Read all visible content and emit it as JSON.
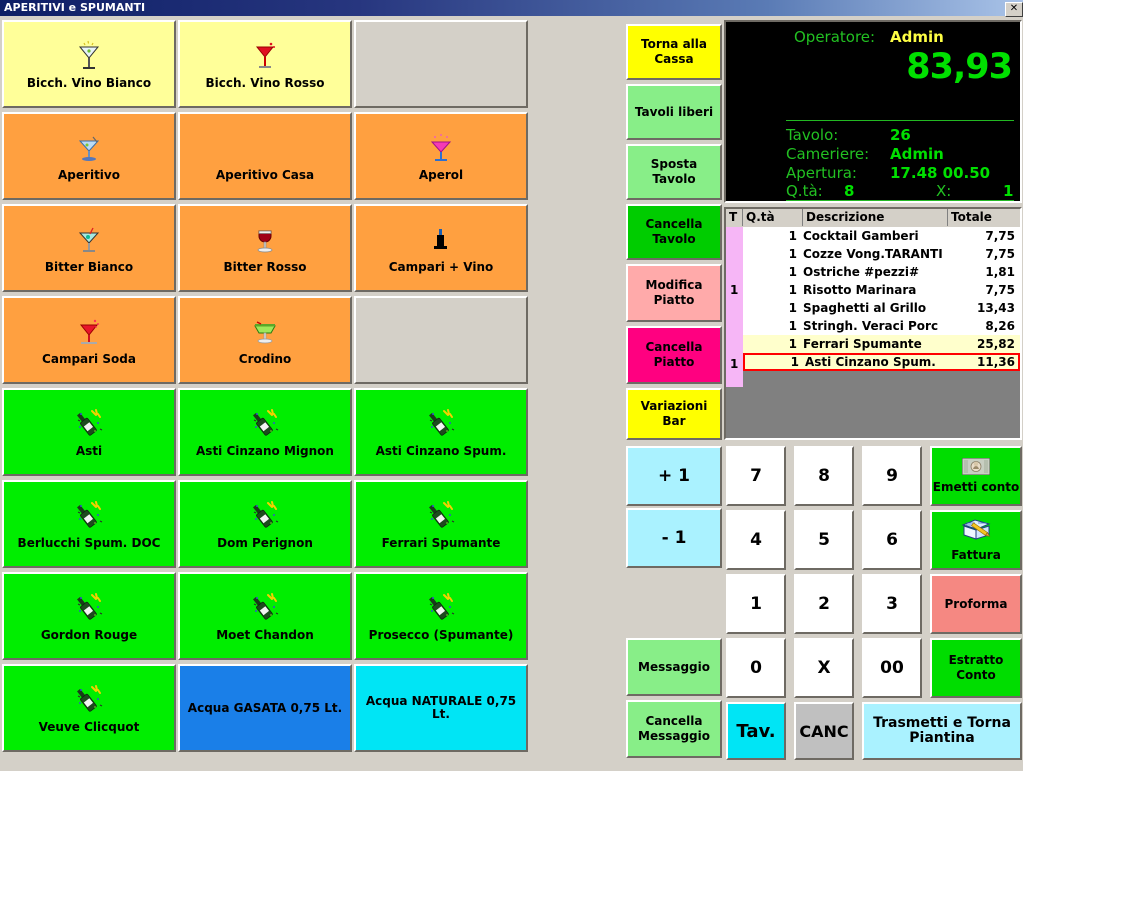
{
  "window": {
    "title": "APERITIVI e SPUMANTI",
    "close_label": "✕"
  },
  "products": [
    {
      "label": "Bicch. Vino Bianco",
      "color": "#ffff99",
      "icon": "cocktail-white-icon"
    },
    {
      "label": "Bicch. Vino Rosso",
      "color": "#ffff99",
      "icon": "cocktail-red-icon"
    },
    {
      "label": "",
      "color": "#d4d0c8",
      "icon": ""
    },
    {
      "label": "Aperitivo",
      "color": "#ffa040",
      "icon": "cocktail-blue-icon"
    },
    {
      "label": "Aperitivo Casa",
      "color": "#ffa040",
      "icon": "jester-icon"
    },
    {
      "label": "Aperol",
      "color": "#ffa040",
      "icon": "cocktail-pink-icon"
    },
    {
      "label": "Bitter Bianco",
      "color": "#ffa040",
      "icon": "cocktail-teal-icon"
    },
    {
      "label": "Bitter Rosso",
      "color": "#ffa040",
      "icon": "wineglass-red-icon"
    },
    {
      "label": "Campari + Vino",
      "color": "#ffa040",
      "icon": "bottle-small-icon"
    },
    {
      "label": "Campari Soda",
      "color": "#ffa040",
      "icon": "cocktail-red-splash-icon"
    },
    {
      "label": "Crodino",
      "color": "#ffa040",
      "icon": "margarita-green-icon"
    },
    {
      "label": "",
      "color": "#d4d0c8",
      "icon": ""
    },
    {
      "label": "Asti",
      "color": "#00ee00",
      "icon": "champagne-bottle-icon"
    },
    {
      "label": "Asti Cinzano Mignon",
      "color": "#00ee00",
      "icon": "champagne-bottle-icon"
    },
    {
      "label": "Asti Cinzano Spum.",
      "color": "#00ee00",
      "icon": "champagne-bottle-icon"
    },
    {
      "label": "Berlucchi Spum. DOC",
      "color": "#00ee00",
      "icon": "champagne-bottle-icon"
    },
    {
      "label": "Dom Perignon",
      "color": "#00ee00",
      "icon": "champagne-bottle-icon"
    },
    {
      "label": "Ferrari Spumante",
      "color": "#00ee00",
      "icon": "champagne-bottle-icon"
    },
    {
      "label": "Gordon Rouge",
      "color": "#00ee00",
      "icon": "champagne-bottle-icon"
    },
    {
      "label": "Moet Chandon",
      "color": "#00ee00",
      "icon": "champagne-bottle-icon"
    },
    {
      "label": "Prosecco (Spumante)",
      "color": "#00ee00",
      "icon": "champagne-bottle-icon"
    },
    {
      "label": "Veuve Clicquot",
      "color": "#00ee00",
      "icon": "champagne-bottle-icon"
    },
    {
      "label": "Acqua GASATA 0,75 Lt.",
      "color": "#1a7fe8",
      "icon": ""
    },
    {
      "label": "Acqua NATURALE 0,75 Lt.",
      "color": "#00e5f5",
      "icon": ""
    }
  ],
  "function_buttons": [
    {
      "label": "Torna alla Cassa",
      "color": "#ffff00"
    },
    {
      "label": "Tavoli liberi",
      "color": "#88ee88"
    },
    {
      "label": "Sposta Tavolo",
      "color": "#88ee88"
    },
    {
      "label": "Cancella Tavolo",
      "color": "#00cc00"
    },
    {
      "label": "Modifica Piatto",
      "color": "#ffaaaa"
    },
    {
      "label": "Cancella Piatto",
      "color": "#ff0080"
    },
    {
      "label": "Variazioni Bar",
      "color": "#ffff00"
    }
  ],
  "display": {
    "operator_label": "Operatore:",
    "operator_value": "Admin",
    "total": "83,93",
    "rows": [
      {
        "label": "Tavolo:",
        "value": "26"
      },
      {
        "label": "Cameriere:",
        "value": "Admin"
      },
      {
        "label": "Apertura:",
        "value": "17.48  00.50"
      }
    ],
    "qty_label": "Q.tà:",
    "qty_value": "8",
    "x_label": "X:",
    "x_value": "1"
  },
  "order_list": {
    "headers": [
      "T",
      "Q.tà",
      "Descrizione",
      "Totale"
    ],
    "table_marks": [
      "1",
      "1"
    ],
    "rows": [
      {
        "qty": "1",
        "desc": "Cocktail Gamberi",
        "total": "7,75",
        "highlight": false,
        "selected": false
      },
      {
        "qty": "1",
        "desc": "Cozze Vong.TARANTI",
        "total": "7,75",
        "highlight": false,
        "selected": false
      },
      {
        "qty": "1",
        "desc": "Ostriche #pezzi#",
        "total": "1,81",
        "highlight": false,
        "selected": false
      },
      {
        "qty": "1",
        "desc": "Risotto Marinara",
        "total": "7,75",
        "highlight": false,
        "selected": false
      },
      {
        "qty": "1",
        "desc": "Spaghetti al Grillo",
        "total": "13,43",
        "highlight": false,
        "selected": false
      },
      {
        "qty": "1",
        "desc": "Stringh. Veraci Porc",
        "total": "8,26",
        "highlight": false,
        "selected": false
      },
      {
        "qty": "1",
        "desc": "Ferrari Spumante",
        "total": "25,82",
        "highlight": true,
        "selected": false
      },
      {
        "qty": "1",
        "desc": "Asti Cinzano Spum.",
        "total": "11,36",
        "highlight": true,
        "selected": true
      }
    ]
  },
  "keypad": {
    "plus_one": "+ 1",
    "minus_one": "- 1",
    "messaggio": "Messaggio",
    "cancella_messaggio": "Cancella Messaggio",
    "n7": "7",
    "n8": "8",
    "n9": "9",
    "n4": "4",
    "n5": "5",
    "n6": "6",
    "n1": "1",
    "n2": "2",
    "n3": "3",
    "n0": "0",
    "mult": "X",
    "dbl0": "00",
    "tav": "Tav.",
    "canc": "CANC",
    "emetti_conto": "Emetti conto",
    "fattura": "Fattura",
    "proforma": "Proforma",
    "estratto_conto": "Estratto Conto",
    "trasmetti": "Trasmetti e Torna Piantina"
  },
  "colors": {
    "titlebar_start": "#0e1f66",
    "cyan": "#aaf2ff",
    "light_green": "#88ee88",
    "green": "#00cc00",
    "salmon": "#f58882",
    "bright_cyan": "#00e5f5",
    "gray": "#c0c0c0",
    "highlight_row": "#ffffcc",
    "selection_border": "#ff0000"
  }
}
